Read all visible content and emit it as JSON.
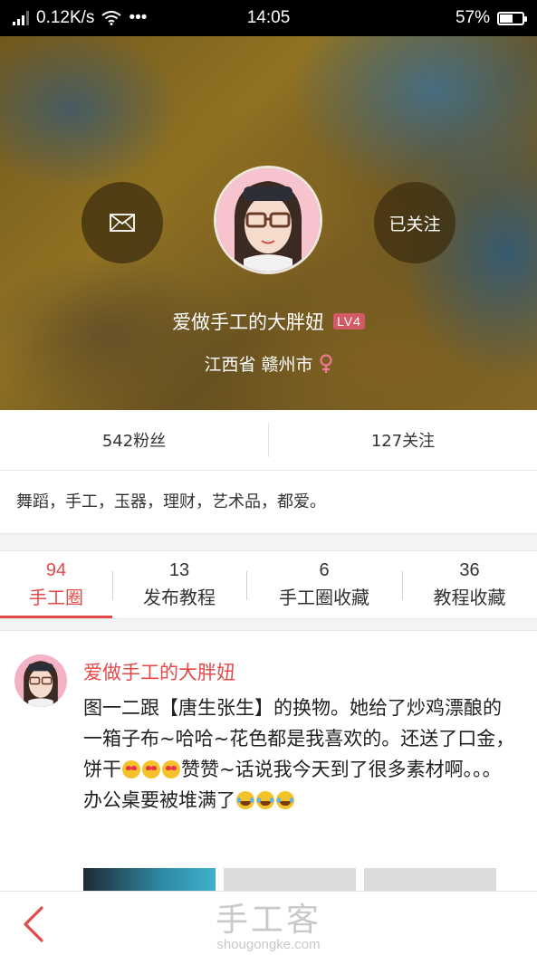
{
  "status_bar": {
    "speed": "0.12K/s",
    "dots": "•••",
    "time": "14:05",
    "battery_text": "57%",
    "battery_level": 0.57
  },
  "profile": {
    "username": "爱做手工的大胖妞",
    "level": "LV4",
    "location": "江西省 赣州市",
    "follow_label": "已关注"
  },
  "stats": {
    "fans": "542粉丝",
    "following": "127关注"
  },
  "bio": "舞蹈，手工，玉器，理财，艺术品，都爱。",
  "tabs": [
    {
      "count": "94",
      "label": "手工圈"
    },
    {
      "count": "13",
      "label": "发布教程"
    },
    {
      "count": "6",
      "label": "手工圈收藏"
    },
    {
      "count": "36",
      "label": "教程收藏"
    }
  ],
  "post": {
    "author": "爱做手工的大胖妞",
    "text_1": "图一二跟【唐生张生】的换物。她给了炒鸡漂酿的一箱子布~哈哈~花色都是我喜欢的。还送了口金，饼干",
    "text_2": "赞赞~话说我今天到了很多素材啊。。。办公桌要被堆满了"
  },
  "watermark": {
    "main": "手工客",
    "sub": "shougongke.com"
  },
  "colors": {
    "accent": "#e24a4a",
    "level_badge": "#dc5a6e"
  },
  "icons": {
    "message": "mail-icon",
    "location": "female-icon",
    "back": "chevron-left-icon"
  }
}
